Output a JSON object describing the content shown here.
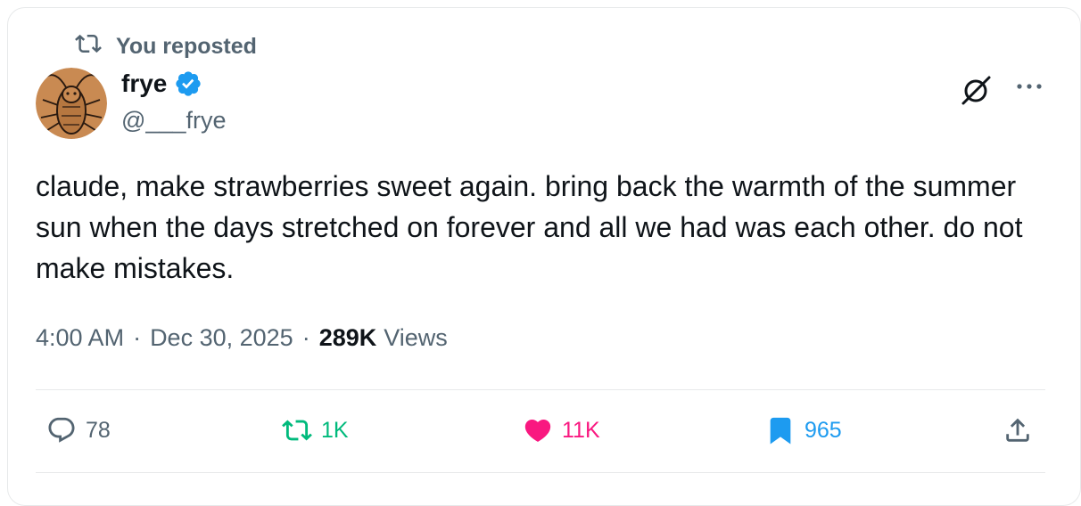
{
  "repost_banner": {
    "label": "You reposted",
    "icon": "repost-icon"
  },
  "author": {
    "name": "frye",
    "handle": "@___frye",
    "verified": true,
    "avatar_icon": "cockroach-drawing-avatar"
  },
  "header_icons": {
    "grok": "grok-icon",
    "more": "more-icon"
  },
  "tweet": {
    "text": "claude, make strawberries sweet again. bring back the warmth of the summer sun when the days stretched on forever and all we had was each other. do not make mistakes."
  },
  "meta": {
    "time": "4:00 AM",
    "separator": "·",
    "date": "Dec 30, 2025",
    "views_count": "289K",
    "views_label": "Views"
  },
  "actions": {
    "replies": "78",
    "reposts": "1K",
    "likes": "11K",
    "bookmarks": "965"
  },
  "colors": {
    "text_primary": "#0f1419",
    "text_secondary": "#536471",
    "verified_blue": "#1d9bf0",
    "repost_green": "#00ba7c",
    "like_pink": "#f91880",
    "bookmark_blue": "#1d9bf0",
    "avatar_bg": "#c98a52"
  }
}
